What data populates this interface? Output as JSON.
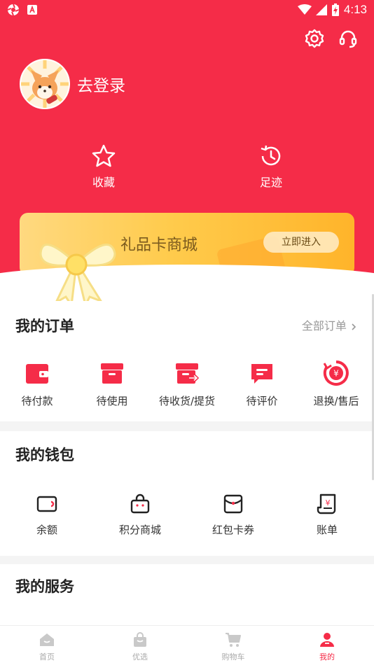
{
  "status_bar": {
    "time": "4:13"
  },
  "header": {
    "login_label": "去登录",
    "quick_actions": [
      {
        "label": "收藏",
        "icon": "star-icon"
      },
      {
        "label": "足迹",
        "icon": "history-icon"
      }
    ]
  },
  "gift_banner": {
    "title": "礼品卡商城",
    "button_label": "立即进入"
  },
  "orders": {
    "title": "我的订单",
    "more_label": "全部订单",
    "items": [
      {
        "label": "待付款",
        "icon": "wallet-icon"
      },
      {
        "label": "待使用",
        "icon": "box-icon"
      },
      {
        "label": "待收货/提货",
        "icon": "truck-icon"
      },
      {
        "label": "待评价",
        "icon": "comment-icon"
      },
      {
        "label": "退换/售后",
        "icon": "refund-icon"
      }
    ]
  },
  "wallet": {
    "title": "我的钱包",
    "items": [
      {
        "label": "余额",
        "icon": "balance-card-icon"
      },
      {
        "label": "积分商城",
        "icon": "shopping-bag-icon"
      },
      {
        "label": "红包卡券",
        "icon": "red-packet-icon"
      },
      {
        "label": "账单",
        "icon": "bill-icon"
      }
    ]
  },
  "services": {
    "title": "我的服务"
  },
  "tabbar": {
    "items": [
      {
        "label": "首页",
        "icon": "home-icon",
        "active": false
      },
      {
        "label": "优选",
        "icon": "bag-icon",
        "active": false
      },
      {
        "label": "购物车",
        "icon": "cart-icon",
        "active": false
      },
      {
        "label": "我的",
        "icon": "user-icon",
        "active": true
      }
    ]
  },
  "colors": {
    "brand": "#f52c48",
    "gift_gold": "#ffc94a"
  }
}
